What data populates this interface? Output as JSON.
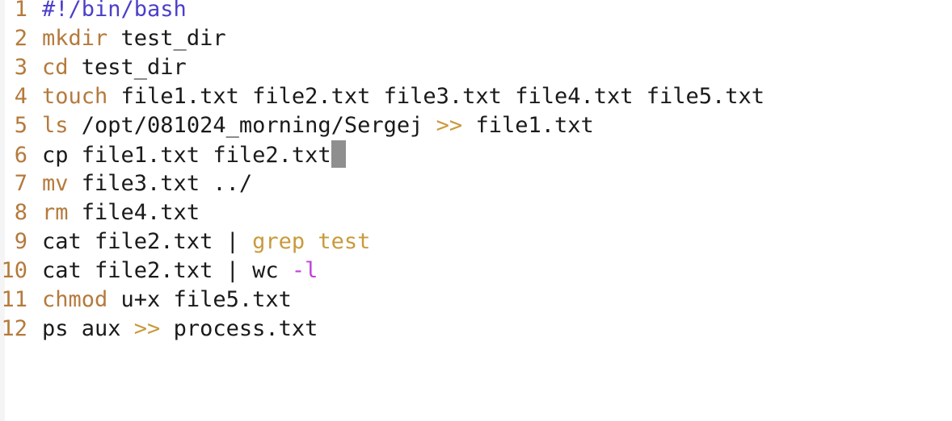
{
  "editor": {
    "cursor_line": 6,
    "lines": [
      {
        "number": "1",
        "tokens": [
          {
            "text": "#!/bin/bash",
            "kind": "shebang"
          }
        ]
      },
      {
        "number": "2",
        "tokens": [
          {
            "text": "mkdir",
            "kind": "kw"
          },
          {
            "text": " test_dir",
            "kind": "text"
          }
        ]
      },
      {
        "number": "3",
        "tokens": [
          {
            "text": "cd",
            "kind": "kw"
          },
          {
            "text": " test_dir",
            "kind": "text"
          }
        ]
      },
      {
        "number": "4",
        "tokens": [
          {
            "text": "touch",
            "kind": "kw"
          },
          {
            "text": " file1.txt file2.txt file3.txt file4.txt file5.txt",
            "kind": "text"
          }
        ]
      },
      {
        "number": "5",
        "tokens": [
          {
            "text": "ls",
            "kind": "kw"
          },
          {
            "text": " /opt/081024_morning/Sergej ",
            "kind": "text"
          },
          {
            "text": ">>",
            "kind": "op"
          },
          {
            "text": " file1.txt",
            "kind": "text"
          }
        ]
      },
      {
        "number": "6",
        "tokens": [
          {
            "text": "cp file1.txt file2.txt",
            "kind": "text"
          }
        ]
      },
      {
        "number": "7",
        "tokens": [
          {
            "text": "mv",
            "kind": "kw"
          },
          {
            "text": " file3.txt ../",
            "kind": "text"
          }
        ]
      },
      {
        "number": "8",
        "tokens": [
          {
            "text": "rm",
            "kind": "kw"
          },
          {
            "text": " file4.txt",
            "kind": "text"
          }
        ]
      },
      {
        "number": "9",
        "tokens": [
          {
            "text": "cat file2.txt | ",
            "kind": "text"
          },
          {
            "text": "grep test",
            "kind": "op"
          }
        ]
      },
      {
        "number": "10",
        "tokens": [
          {
            "text": "cat file2.txt | wc ",
            "kind": "text"
          },
          {
            "text": "-l",
            "kind": "flag"
          }
        ]
      },
      {
        "number": "11",
        "tokens": [
          {
            "text": "chmod",
            "kind": "kw"
          },
          {
            "text": " u+x file5.txt",
            "kind": "text"
          }
        ]
      },
      {
        "number": "12",
        "tokens": [
          {
            "text": "ps aux ",
            "kind": "text"
          },
          {
            "text": ">>",
            "kind": "op"
          },
          {
            "text": " process.txt",
            "kind": "text"
          }
        ]
      }
    ]
  },
  "colors": {
    "keyword": "#b57a3c",
    "shebang": "#4b3fc9",
    "operator": "#c99a3c",
    "flag": "#c03fd6",
    "text": "#1a1a1a",
    "cursor": "#8f8f8f"
  }
}
